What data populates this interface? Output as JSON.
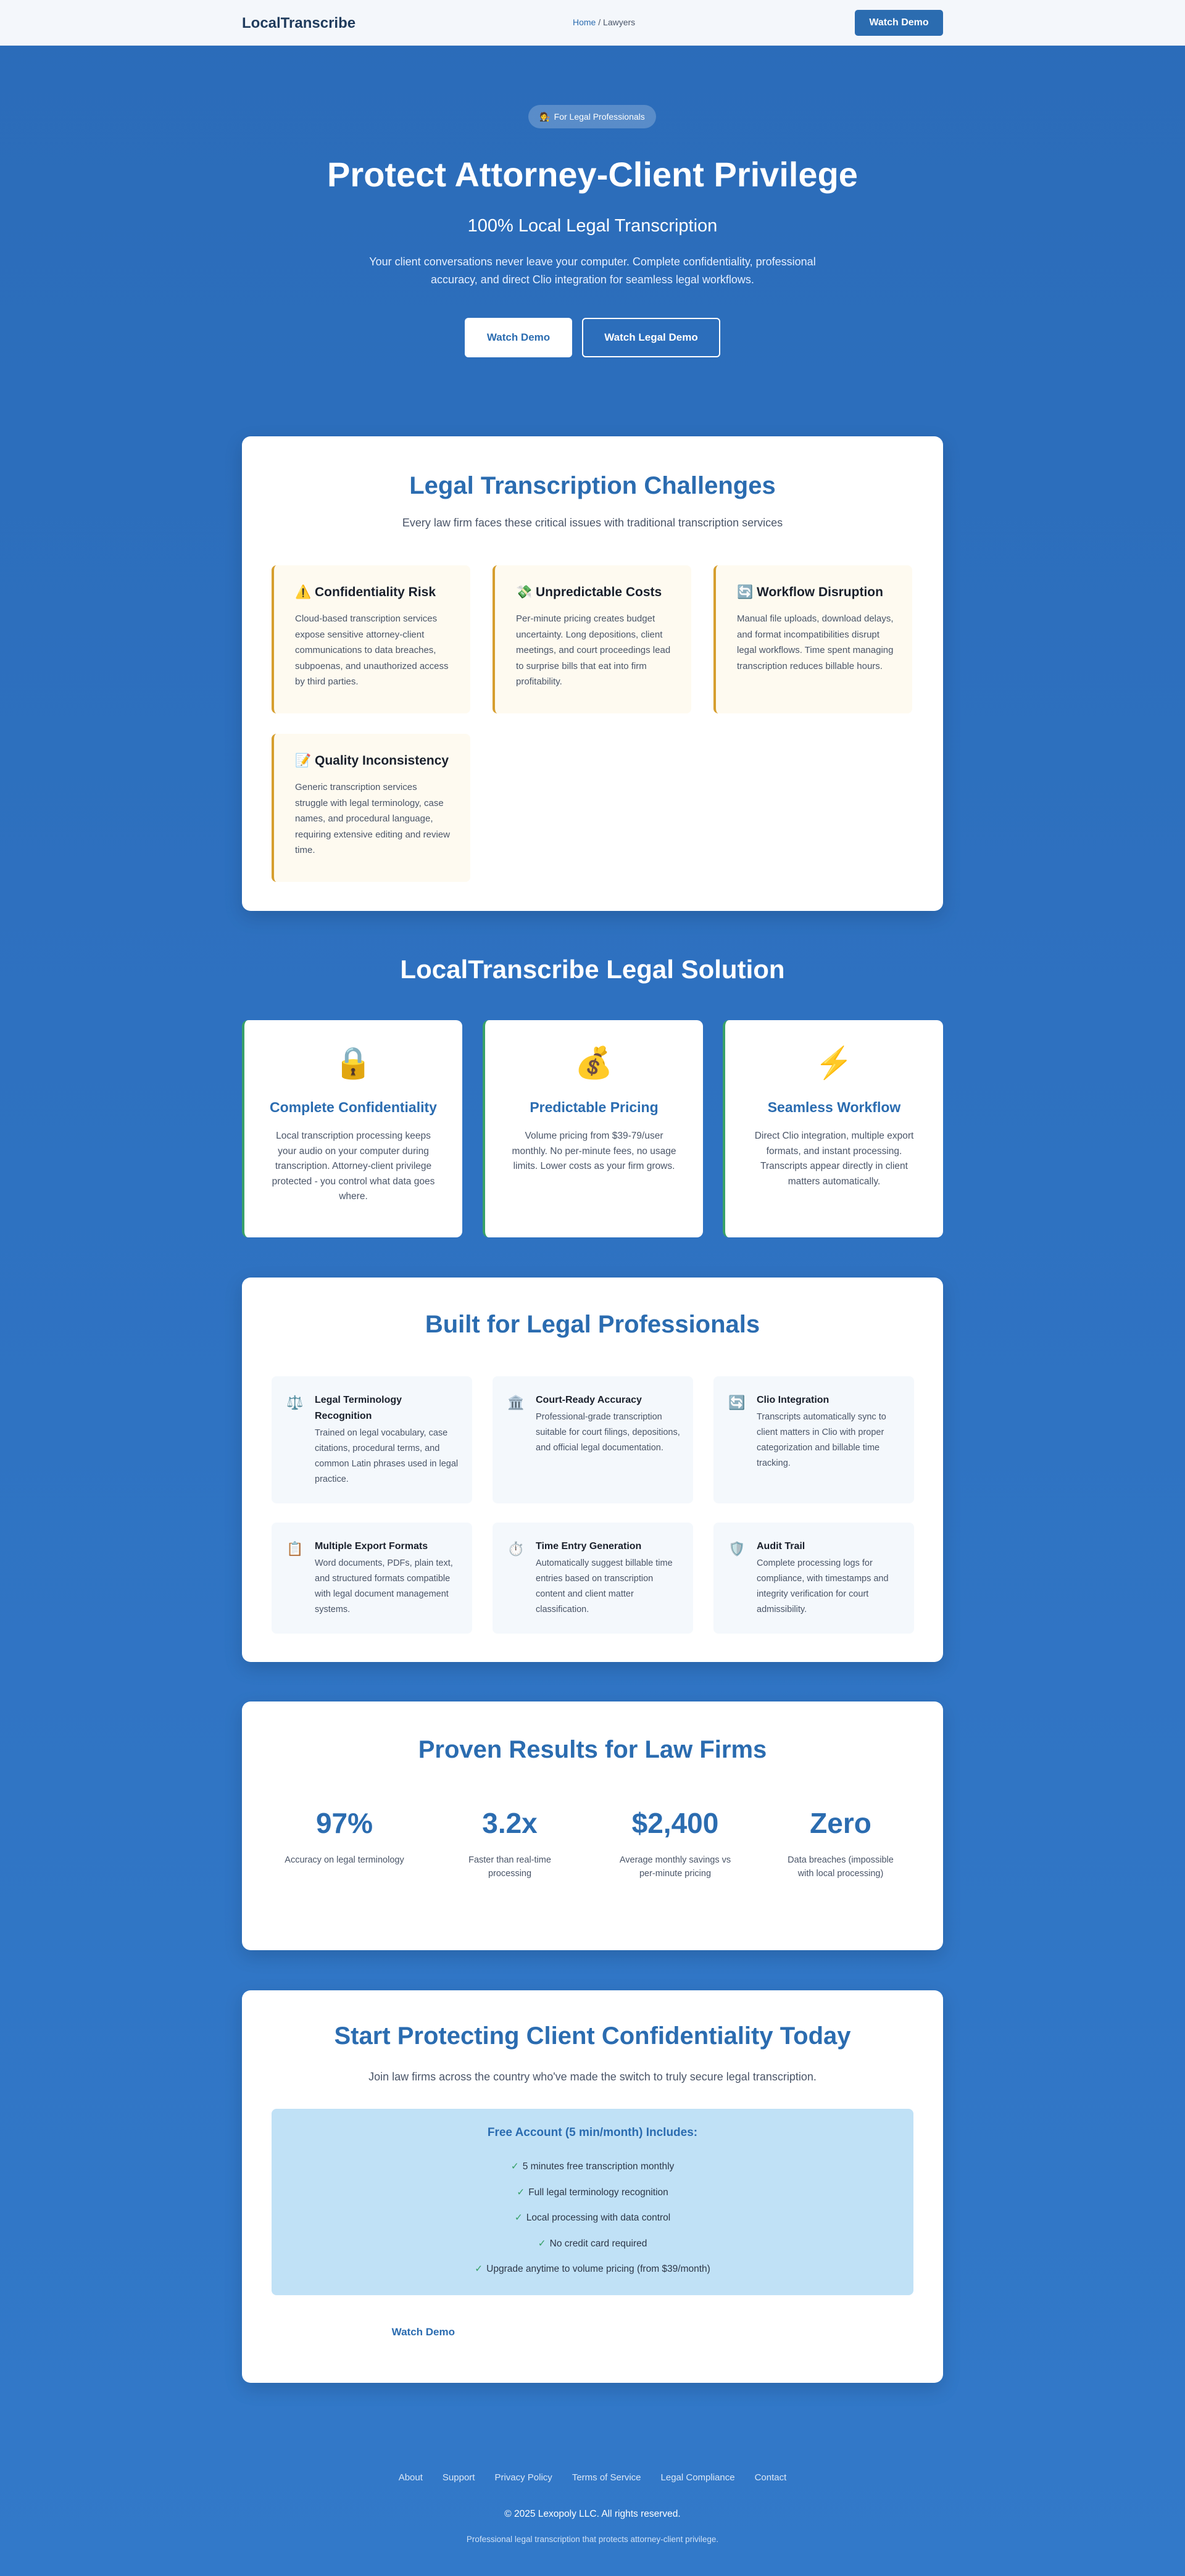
{
  "header": {
    "brand": "LocalTranscribe",
    "breadcrumb_home": "Home",
    "breadcrumb_sep": " / ",
    "breadcrumb_current": "Lawyers",
    "cta_label": "Watch Demo"
  },
  "hero": {
    "badge_icon": "🧑‍⚖️",
    "badge_text": "For Legal Professionals",
    "title": "Protect Attorney-Client Privilege",
    "subtitle": "100% Local Legal Transcription",
    "description": "Your client conversations never leave your computer. Complete confidentiality, professional accuracy, and direct Clio integration for seamless legal workflows.",
    "primary_button": "Watch Demo",
    "secondary_button": "Watch Legal Demo"
  },
  "challenges": {
    "title": "Legal Transcription Challenges",
    "subtitle": "Every law firm faces these critical issues with traditional transcription services",
    "items": [
      {
        "icon": "⚠️",
        "title": "Confidentiality Risk",
        "text": "Cloud-based transcription services expose sensitive attorney-client communications to data breaches, subpoenas, and unauthorized access by third parties."
      },
      {
        "icon": "💸",
        "title": "Unpredictable Costs",
        "text": "Per-minute pricing creates budget uncertainty. Long depositions, client meetings, and court proceedings lead to surprise bills that eat into firm profitability."
      },
      {
        "icon": "🔄",
        "title": "Workflow Disruption",
        "text": "Manual file uploads, download delays, and format incompatibilities disrupt legal workflows. Time spent managing transcription reduces billable hours."
      },
      {
        "icon": "📝",
        "title": "Quality Inconsistency",
        "text": "Generic transcription services struggle with legal terminology, case names, and procedural language, requiring extensive editing and review time."
      }
    ]
  },
  "solution": {
    "title": "LocalTranscribe Legal Solution",
    "items": [
      {
        "icon": "🔒",
        "title": "Complete Confidentiality",
        "text": "Local transcription processing keeps your audio on your computer during transcription. Attorney-client privilege protected - you control what data goes where."
      },
      {
        "icon": "💰",
        "title": "Predictable Pricing",
        "text": "Volume pricing from $39-79/user monthly. No per-minute fees, no usage limits. Lower costs as your firm grows."
      },
      {
        "icon": "⚡",
        "title": "Seamless Workflow",
        "text": "Direct Clio integration, multiple export formats, and instant processing. Transcripts appear directly in client matters automatically."
      }
    ]
  },
  "features": {
    "title": "Built for Legal Professionals",
    "items": [
      {
        "icon": "⚖️",
        "title": "Legal Terminology Recognition",
        "text": "Trained on legal vocabulary, case citations, procedural terms, and common Latin phrases used in legal practice."
      },
      {
        "icon": "🏛️",
        "title": "Court-Ready Accuracy",
        "text": "Professional-grade transcription suitable for court filings, depositions, and official legal documentation."
      },
      {
        "icon": "🔄",
        "title": "Clio Integration",
        "text": "Transcripts automatically sync to client matters in Clio with proper categorization and billable time tracking."
      },
      {
        "icon": "📋",
        "title": "Multiple Export Formats",
        "text": "Word documents, PDFs, plain text, and structured formats compatible with legal document management systems."
      },
      {
        "icon": "⏱️",
        "title": "Time Entry Generation",
        "text": "Automatically suggest billable time entries based on transcription content and client matter classification."
      },
      {
        "icon": "🛡️",
        "title": "Audit Trail",
        "text": "Complete processing logs for compliance, with timestamps and integrity verification for court admissibility."
      }
    ]
  },
  "results": {
    "title": "Proven Results for Law Firms",
    "stats": [
      {
        "value": "97%",
        "label": "Accuracy on legal terminology"
      },
      {
        "value": "3.2x",
        "label": "Faster than real-time processing"
      },
      {
        "value": "$2,400",
        "label": "Average monthly savings vs per-minute pricing"
      },
      {
        "value": "Zero",
        "label": "Data breaches (impossible with local processing)"
      }
    ]
  },
  "cta": {
    "title": "Start Protecting Client Confidentiality Today",
    "subtitle": "Join law firms across the country who've made the switch to truly secure legal transcription.",
    "box_title": "Free Account (5 min/month) Includes:",
    "check": "✓",
    "includes": [
      "5 minutes free transcription monthly",
      "Full legal terminology recognition",
      "Local processing with data control",
      "No credit card required",
      "Upgrade anytime to volume pricing (from $39/month)"
    ],
    "link": "Watch Demo"
  },
  "footer": {
    "links": [
      "About",
      "Support",
      "Privacy Policy",
      "Terms of Service",
      "Legal Compliance",
      "Contact"
    ],
    "copyright": "© 2025 Lexopoly LLC. All rights reserved.",
    "tagline": "Professional legal transcription that protects attorney-client privilege."
  }
}
